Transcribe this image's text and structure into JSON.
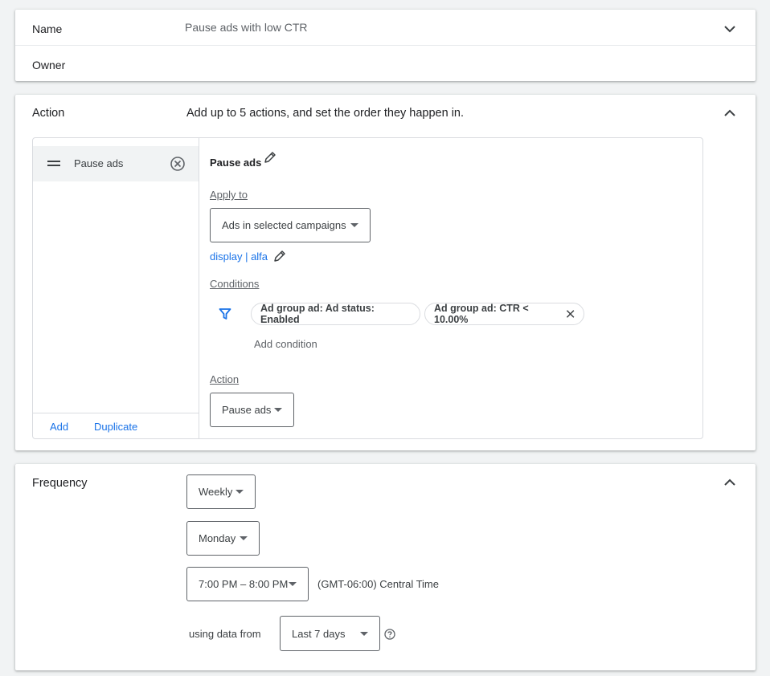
{
  "name_section": {
    "name_label": "Name",
    "name_value": "Pause ads with low CTR",
    "owner_label": "Owner"
  },
  "action_section": {
    "label": "Action",
    "description": "Add up to 5 actions, and set the order they happen in.",
    "list": {
      "items": [
        {
          "label": "Pause ads"
        }
      ],
      "add_label": "Add",
      "duplicate_label": "Duplicate"
    },
    "detail": {
      "title": "Pause ads",
      "apply_to_label": "Apply to",
      "apply_to_value": "Ads in selected campaigns",
      "campaigns_link": "display | alfa",
      "conditions_label": "Conditions",
      "conditions": [
        {
          "text": "Ad group ad: Ad status: Enabled",
          "removable": false
        },
        {
          "text": "Ad group ad: CTR < 10.00%",
          "removable": true
        }
      ],
      "add_condition_label": "Add condition",
      "action_label": "Action",
      "action_value": "Pause ads"
    }
  },
  "frequency_section": {
    "label": "Frequency",
    "frequency_value": "Weekly",
    "day_value": "Monday",
    "time_value": "7:00 PM – 8:00 PM",
    "timezone": "(GMT-06:00) Central Time",
    "using_data_label": "using data from",
    "data_range_value": "Last 7 days"
  },
  "colors": {
    "accent": "#1a73e8",
    "background": "#f1f3f4",
    "selected_item": "#f1f3f4"
  }
}
